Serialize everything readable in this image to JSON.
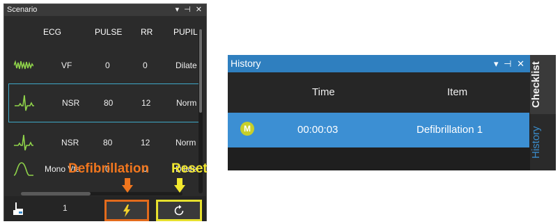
{
  "scenario": {
    "title": "Scenario",
    "controls": "▾ ⊣ ✕",
    "columns": [
      "ECG",
      "PULSE",
      "RR",
      "PUPIL"
    ],
    "rows": [
      {
        "ecg": "VF",
        "pulse": "0",
        "rr": "0",
        "pupil": "Dilate",
        "wave": "vf-waveform-icon"
      },
      {
        "ecg": "NSR",
        "pulse": "80",
        "rr": "12",
        "pupil": "Norm",
        "wave": "nsr-waveform-icon",
        "selected": true
      },
      {
        "ecg": "NSR",
        "pulse": "80",
        "rr": "12",
        "pupil": "Norm",
        "wave": "nsr-waveform-icon"
      },
      {
        "ecg": "Mono Vta",
        "pulse": "0",
        "rr": "0",
        "pupil": "Dilate",
        "wave": "mono-vt-waveform-icon"
      }
    ],
    "footer": {
      "count": "1",
      "defib_icon": "lightning-icon",
      "reset_icon": "reset-icon"
    },
    "colors": {
      "defib": "#e36b1c",
      "reset": "#e6e02e",
      "selected_border": "#3fa9c9"
    }
  },
  "callouts": {
    "defibrillation": "Defibrillation",
    "reset": "Reset"
  },
  "history": {
    "title": "History",
    "controls": "▾ ⊣ ✕",
    "columns": {
      "time": "Time",
      "item": "Item"
    },
    "rows": [
      {
        "badge": "M",
        "time": "00:00:03",
        "item": "Defibrillation 1"
      }
    ],
    "colors": {
      "title_bar": "#2f7fbf",
      "row": "#3c8fd3",
      "badge": "#c7cf2a"
    }
  },
  "side_tabs": {
    "checklist": "Checklist",
    "history": "History"
  }
}
